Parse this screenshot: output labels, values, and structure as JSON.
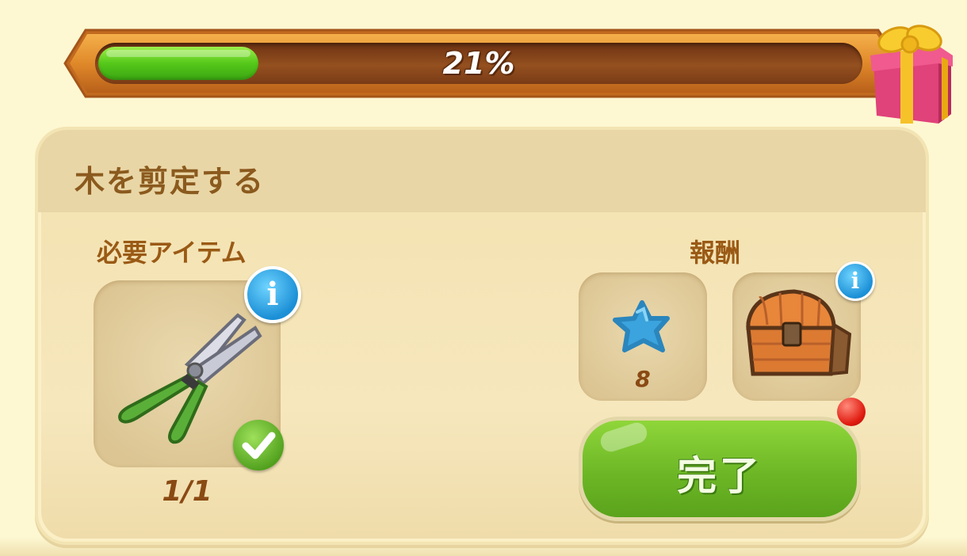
{
  "progress": {
    "percent_label": "21%",
    "fill_fraction": 0.21,
    "reward_icon": "gift-box-icon"
  },
  "task": {
    "title": "木を剪定する"
  },
  "required": {
    "label": "必要アイテム",
    "item_icon": "pruning-shears-icon",
    "count": "1/1"
  },
  "rewards": {
    "label": "報酬",
    "items": [
      {
        "icon": "blue-star-icon",
        "amount": "8"
      },
      {
        "icon": "treasure-chest-icon"
      }
    ]
  },
  "complete_button": {
    "label": "完了"
  },
  "colors": {
    "background": "#fdf8d2",
    "progress_fill": "#55c81a",
    "button_green": "#6db726",
    "title_brown": "#8b5a1e",
    "info_blue": "#1b8fd6"
  }
}
